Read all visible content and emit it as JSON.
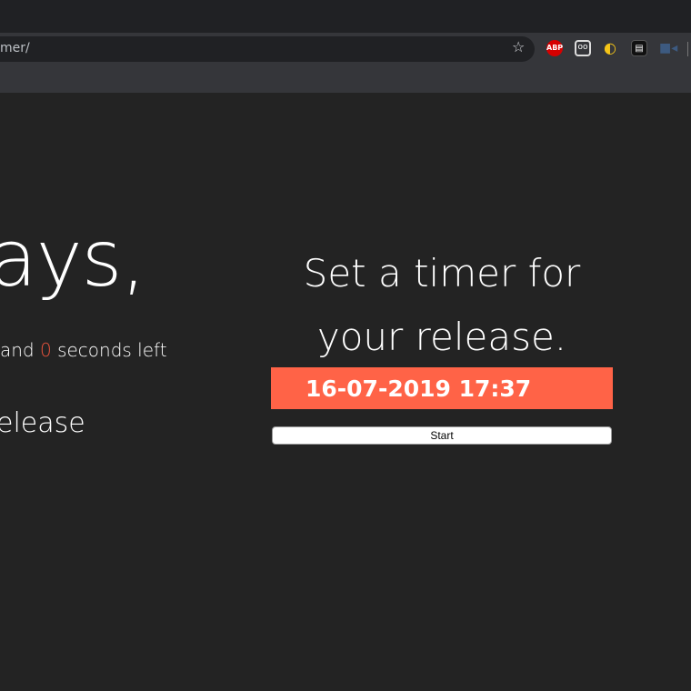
{
  "browser": {
    "url": "mer/",
    "extensions": [
      "abp-icon",
      "ghostery-icon",
      "circle-play-icon",
      "news-icon",
      "camera-icon"
    ],
    "abp_label": "ABP"
  },
  "countdown": {
    "big_text": "ays,",
    "prefix": "and ",
    "seconds": "0",
    "suffix": " seconds left",
    "release_text": "elease"
  },
  "form": {
    "heading_line1": "Set a timer for",
    "heading_line2": "your release.",
    "date_value": "16-07-2019 17:37",
    "start_label": "Start"
  },
  "colors": {
    "accent": "#ff6347",
    "background": "#232323"
  }
}
